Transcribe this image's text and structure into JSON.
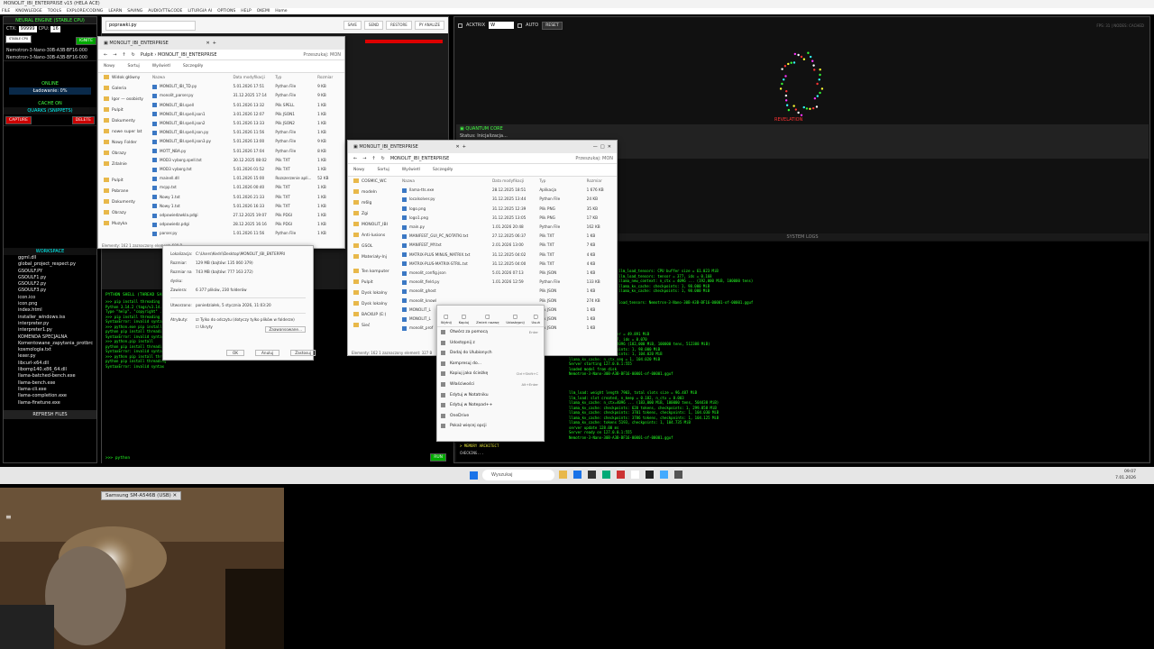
{
  "window_title": "MONOLIT_IBI_ENTERPRISE v15 (HELA ACE)",
  "menu": [
    "FILE",
    "KNOWLEDGE",
    "TOOLS",
    "EXPLORE/CODING",
    "LEARN",
    "SAVING",
    "AUDIO/TT&CODE",
    "LITURGIA AI",
    "OPTIONS",
    "HELP",
    "OKEMI",
    "Home"
  ],
  "left_panel": {
    "engine_title": "NEURAL ENGINE (STABLE CPU)",
    "ctx_label": "CTX:",
    "ctx_value": "99999",
    "cpu_label": "CPU:",
    "cpu_value": "16",
    "ignite": "IGNITE",
    "models": [
      "Nemotron-3-Nano-30B-A3B-BF16-000",
      "Nemotron-3-Nano-30B-A3B-BF16-000"
    ],
    "online": "ONLINE",
    "loading": "Ładowanie: 0%",
    "cache": "CACHE ON",
    "quarks_title": "QUARKS (SNIPPETS)",
    "capture": "CAPTURE",
    "delete": "DELETE",
    "workspace_title": "WORKSPACE",
    "workspace_files": [
      "ggml.dll",
      "global_project_respect.py",
      "GSOULF.PY",
      "GSOULF1.py",
      "GSOULF2.py",
      "GSOULF3.py",
      "icon.ico",
      "icon.png",
      "index.html",
      "installer_windows.iss",
      "interpreter.py",
      "interpreter1.py",
      "KOMENDA SPECJALNA",
      "Komentowane_zapytania_protbrc",
      "kosmologia.txt",
      "lexer.py",
      "libcurl-x64.dll",
      "libomp140.x86_64.dll",
      "llama-batched-bench.exe",
      "llama-bench.exe",
      "llama-cli.exe",
      "llama-completion.exe",
      "llama-finetune.exe"
    ],
    "refresh": "REFRESH FILES"
  },
  "center": {
    "search_placeholder": "poprawki.py",
    "buttons": [
      "SAVE",
      "SEND",
      "RESTORE",
      "PY ANALIZE"
    ],
    "shell_title": "PYTHON SHELL (THREAD SAFE)",
    "shell_lines": [
      ">>> pip install threading",
      "Python 3.14.2 (tags/v3.14.2:...)",
      "Type \"help\", \"copyright\" ...",
      ">>> pip install threading",
      "SyntaxError: invalid syntax",
      ">>> python.exe pip install",
      "python pip install threading",
      "SyntaxError: invalid syntax",
      ">>> python.pip install",
      "python pip install threading",
      "SyntaxError: invalid syntax",
      "",
      ">>> python pip install threading",
      "python pip install threading",
      "SyntaxError: invalid syntax"
    ],
    "prompt": ">>> python",
    "run": "RUN"
  },
  "right_panel": {
    "acktrix": "ACKTRIX",
    "acktrix_value": "W",
    "auto": "AUTO",
    "reset": "RESET",
    "fps": "FPS: 31 | NODES: CACHED",
    "revelation": "REVELATION",
    "quantum_title": "QUANTUM CORE",
    "quantum_status": "Status: Inicjalizacja...",
    "system_logs": "SYSTEM LOGS",
    "logs_top": [
      "llm_load_tensors: CPU buffer size = 61.023 MiB",
      "llm_load_tensors: tensor = 377, ids = 0.168",
      "llama_new_context: n_ctx = 4096 ... (192,000 MiB, 100000 tens)",
      "llama_kv_cache: checkpoints: 1, 98.000 MiB",
      "llama_kv_cache: checkpoints: 1, 98.000 MiB"
    ],
    "logs_mid": [
      "load_tensors: Nemotron-3-Nano-30B-A3B-BF16-00001-of-00001.gguf"
    ],
    "logs_bottom": [
      "llm_load: compute buffer = 49.891 MiB",
      "llm_load: tensors = 377, ids = 0.070",
      "llama_kv_cache: n_ctx=4096 (182,000 MiB, 100000 tens, 512388 MiB)",
      "llama_kv_cache: checkpoints: 1, 98.000 MiB",
      "llama_kv_cache: checkpoints: 1, 104.020 MiB",
      "llama_kv_cache: n_ctx_seq = 1, 104.020 MiB",
      "Server starting 127.0.0.1:555",
      "loaded model from disk",
      "Nemotron-3-Nano-30B-A3B-BF16-00001-of-00001.gguf"
    ],
    "logs_end": [
      "llm_load: weight length 7903, total slots size = 96.487 MiB",
      "llm_load: slot created, n_keep = 0.182, n_ctx = 8.003",
      "llama_kv_cache: n_ctx=4096 ... (183,000 MiB, 100000 tens, 504438 MiB)",
      "llama_kv_cache: checkpoints: 620 tokens, checkpoints: 1, 299.858 MiB",
      "llama_kv_cache: checkpoints: 3701 tokens, checkpoints: 1, 104.030 MiB",
      "llama_kv_cache: checkpoints: 3786 tokens, checkpoints: 1, 104.125 MiB",
      "llama_kv_cache: tokens 5193, checkpoints: 1, 104.735 MiB",
      "server update 128.00 ms",
      "Server ready on 127.0.0.1:555",
      "Nemotron-3-Nano-30B-A3B-BF16-00001-of-00001.gguf"
    ],
    "memory": "> MEMORY ARCHITECT",
    "checking": "CHECKING..."
  },
  "explorer1": {
    "tab": "MONOLIT_IBI_ENTERPRISE",
    "path": [
      "Pulpit",
      "MONOLIT_IBI_ENTERPRISE"
    ],
    "search": "Przeszukaj: MON",
    "toolbar": [
      "Nowy",
      "Sortuj",
      "Wyświetl",
      "Szczegóły"
    ],
    "sidebar": [
      "Widok główny",
      "Galeria",
      "Igor — osobisty",
      "Pulpit",
      "Dokumenty",
      "nowe super lat",
      "Nowy Folder",
      "Obrazy",
      "Zdalnie"
    ],
    "sidebar2": [
      "Pulpit",
      "Pobrane",
      "Dokumenty",
      "Obrazy",
      "Muzyka"
    ],
    "headers": [
      "Nazwa",
      "Data modyfikacji",
      "Typ",
      "Rozmiar"
    ],
    "rows": [
      [
        "MONOLIT_IBI_TD.py",
        "5.01.2026 17:51",
        "Python File",
        "9 KB"
      ],
      [
        "monolit_parser.py",
        "31.12.2025 17:14",
        "Python File",
        "9 KB"
      ],
      [
        "MONOLIT_IBI.spell",
        "5.01.2026 13:32",
        "Plik SPELL",
        "1 KB"
      ],
      [
        "MONOLIT_IBI.spell.json1",
        "3.01.2026 12:07",
        "Plik JSON1",
        "1 KB"
      ],
      [
        "MONOLIT_IBI.spell.json2",
        "5.01.2026 13:33",
        "Plik JSON2",
        "1 KB"
      ],
      [
        "MONOLIT_IBI.spell.json.py",
        "5.01.2026 11:56",
        "Python File",
        "1 KB"
      ],
      [
        "MONOLIT_IBI.spell.json3.py",
        "5.01.2026 13:00",
        "Python File",
        "9 KB"
      ],
      [
        "MOTT_NBA.py",
        "5.01.2026 17:04",
        "Python File",
        "8 KB"
      ],
      [
        "MOD3 vyborg.spell.txt",
        "30.12.2025 08:02",
        "Plik TXT",
        "1 KB"
      ],
      [
        "MOD3 vyborg.txt",
        "5.01.2026 01:52",
        "Plik TXT",
        "1 KB"
      ],
      [
        "mainell.dll",
        "1.01.2026 15:00",
        "Rozszerzenie apli...",
        "52 KB"
      ],
      [
        "mcpp.txt",
        "1.01.2026 00:40",
        "Plik TXT",
        "1 KB"
      ],
      [
        "Nowy 1.txt",
        "5.01.2026 21:33",
        "Plik TXT",
        "1 KB"
      ],
      [
        "Nowy 1.txt",
        "5.01.2026 16:33",
        "Plik TXT",
        "1 KB"
      ],
      [
        "odpowiedzwkla.pdgi",
        "27.12.2025 19:07",
        "Plik PDGI",
        "1 KB"
      ],
      [
        "odpowiedz.pdgi",
        "28.12.2025 16:16",
        "Plik PDGI",
        "1 KB"
      ],
      [
        "parser.py",
        "1.01.2026 11:56",
        "Python File",
        "1 KB"
      ]
    ],
    "status": "Elementy: 162   1 zaznaczony element: 609 B"
  },
  "properties": {
    "location_label": "Lokalizacja:",
    "location": "C:\\Users\\Kedri\\Desktop\\MONOLIT_IBI_ENTERPRI",
    "size_label": "Rozmiar:",
    "size": "129 MB (bajtów: 135 060 379)",
    "disk_label": "Rozmiar na dysku:",
    "disk": "743 MB (bajtów: 777 163 272)",
    "contains_label": "Zawiera:",
    "contains": "6 377 plików, 230 folderów",
    "created_label": "Utworzono:",
    "created": "poniedziałek, 5 stycznia 2026, 11:03:20",
    "attr_label": "Atrybuty:",
    "readonly": "Tylko do odczytu (dotyczy tylko plików w folderze)",
    "hidden": "Ukryty",
    "advanced": "Zaawansowane...",
    "ok": "OK",
    "cancel": "Anuluj",
    "apply": "Zastosuj"
  },
  "explorer2": {
    "tab": "MONOLIT_IBI_ENTERPRISE",
    "path": [
      "MONOLIT_IBI_ENTERPRISE"
    ],
    "search": "Przeszukaj: MON",
    "toolbar": [
      "Nowy",
      "Sortuj",
      "Wyświetl",
      "Szczegóły"
    ],
    "sidebar": [
      "COSMIC_WC",
      "modeln",
      "m6lg",
      "Zgi",
      "MONOLIT_IBI",
      "Anti-lusions",
      "GSOL",
      "Materiały-Inj"
    ],
    "sidebar2": [
      "Ten komputer",
      "Pulpit",
      "Dysk lokalny",
      "Dysk lokalny",
      "BACKUP (E:)",
      "Sieć"
    ],
    "headers": [
      "Nazwa",
      "Data modyfikacji",
      "Typ",
      "Rozmiar"
    ],
    "rows": [
      [
        "llama-tts.exe",
        "28.12.2025 18:51",
        "Aplikacja",
        "1 676 KB"
      ],
      [
        "localsolver.py",
        "31.12.2025 13:44",
        "Python File",
        "24 KB"
      ],
      [
        "logo.png",
        "31.12.2025 12:39",
        "Plik PNG",
        "35 KB"
      ],
      [
        "logo1.png",
        "31.12.2025 13:05",
        "Plik PNG",
        "17 KB"
      ],
      [
        "main.py",
        "1.01.2026 20:48",
        "Python File",
        "162 KB"
      ],
      [
        "MANIFEST_GUI_PC_NOTATKI.txt",
        "27.12.2025 06:37",
        "Plik TXT",
        "1 KB"
      ],
      [
        "MANIFEST_MY.txt",
        "2.01.2026 13:00",
        "Plik TXT",
        "7 KB"
      ],
      [
        "MATRIX-PLUS MINUS_MATRIX.txt",
        "31.12.2025 04:02",
        "Plik TXT",
        "4 KB"
      ],
      [
        "MATRIX-PLUS-MATRIX-STRIL.txt",
        "31.12.2025 04:00",
        "Plik TXT",
        "4 KB"
      ],
      [
        "monolit_config.json",
        "5.01.2026 07:13",
        "Plik JSON",
        "1 KB"
      ],
      [
        "monolit_field.py",
        "1.01.2026 12:59",
        "Python File",
        "133 KB"
      ],
      [
        "monolit_ghost",
        "",
        "Plik JSON",
        "1 KB"
      ],
      [
        "monolit_knowl",
        "",
        "Plik JSON",
        "274 KB"
      ],
      [
        "MONOLIT_L",
        "",
        "Plik JSON",
        "1 KB"
      ],
      [
        "MONOLIT_L",
        "",
        "Plik JSON",
        "1 KB"
      ],
      [
        "monolit_prof",
        "",
        "Plik JSON",
        "1 KB"
      ]
    ],
    "status": "Elementy: 162   1 zaznaczony element: 327 B"
  },
  "context_menu": {
    "top": [
      "Wytnij",
      "Kopiuj",
      "Zmień nazwę",
      "Udostępnij",
      "Usuń"
    ],
    "items": [
      "Otwórz za pomocą",
      "Udostępnij z",
      "Dodaj do Ulubionych",
      "Kompresuj do...",
      "Kopiuj jako ścieżkę",
      "Właściwości",
      "Edytuj w Notatniku",
      "Edytuj w Notepad++",
      "OneDrive",
      "Pokaż więcej opcji"
    ],
    "shortcuts": [
      "Enter",
      "",
      "",
      "",
      "Ctrl+Shift+C",
      "Alt+Enter",
      "",
      "",
      "",
      ""
    ]
  },
  "taskbar": {
    "search": "Wyszukaj",
    "clock": "09:07",
    "date": "7.01.2026"
  },
  "webcam": {
    "device": "Samsung SM-A546B (USB)"
  }
}
